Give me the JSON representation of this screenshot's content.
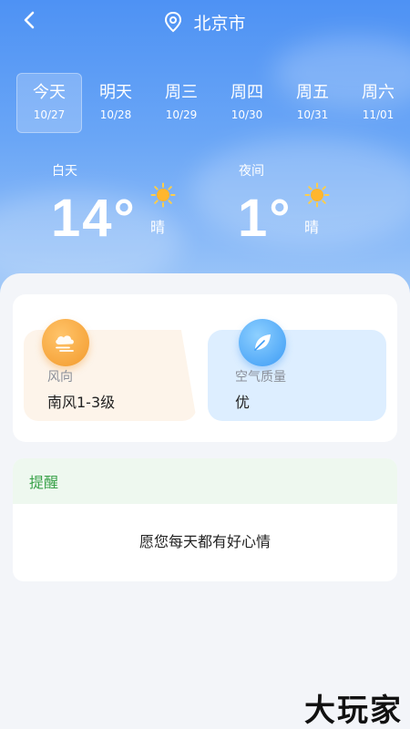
{
  "header": {
    "back_icon": "chevron-left-icon",
    "location_icon": "map-pin-icon",
    "city": "北京市"
  },
  "tabs": [
    {
      "name": "今天",
      "date": "10/27",
      "active": true
    },
    {
      "name": "明天",
      "date": "10/28",
      "active": false
    },
    {
      "name": "周三",
      "date": "10/29",
      "active": false
    },
    {
      "name": "周四",
      "date": "10/30",
      "active": false
    },
    {
      "name": "周五",
      "date": "10/31",
      "active": false
    },
    {
      "name": "周六",
      "date": "11/01",
      "active": false
    }
  ],
  "day": {
    "label": "白天",
    "temp": "14°",
    "condition": "晴",
    "icon": "sun-icon"
  },
  "night": {
    "label": "夜间",
    "temp": "1°",
    "condition": "晴",
    "icon": "sun-icon"
  },
  "wind": {
    "label": "风向",
    "value": "南风1-3级",
    "icon": "wind-cloud-icon"
  },
  "air": {
    "label": "空气质量",
    "value": "优",
    "icon": "leaf-icon"
  },
  "reminder": {
    "title": "提醒",
    "message": "愿您每天都有好心情"
  },
  "watermark": "大玩家",
  "colors": {
    "sky_top": "#4e92f4",
    "sky_bottom": "#a4cbf8",
    "wind_accent": "#f39a2c",
    "air_accent": "#3c9bf5",
    "reminder_green": "#3aa24a"
  }
}
